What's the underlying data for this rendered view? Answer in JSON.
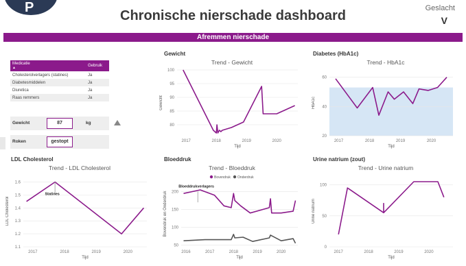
{
  "header": {
    "logo_text": "P",
    "title": "Chronische nierschade dashboard",
    "gender_label": "Geslacht",
    "gender_value": "V"
  },
  "banner": "Afremmen nierschade",
  "medication_table": {
    "headers": [
      "Medicatie",
      "Gebruik"
    ],
    "rows": [
      [
        "Cholesterolverlagers (statines)",
        "Ja"
      ],
      [
        "Diabetesmiddelen",
        "Ja"
      ],
      [
        "Diuretica",
        "Ja"
      ],
      [
        "Raas remmers",
        "Ja"
      ]
    ]
  },
  "fields": {
    "weight_label": "Gewicht",
    "weight_value": "87",
    "weight_unit": "kg",
    "smoking_label": "Roken",
    "smoking_value": "gestopt"
  },
  "panels": {
    "weight": {
      "section": "Gewicht",
      "title": "Trend - Gewicht",
      "xlabel": "Tijd",
      "ylabel": "Gewicht"
    },
    "diabetes": {
      "section": "Diabetes (HbA1c)",
      "title": "Trend - HbA1c",
      "xlabel": "Tijd",
      "ylabel": "HbA1c"
    },
    "ldl": {
      "section": "LDL Cholesterol",
      "title": "Trend - LDL Cholesterol",
      "xlabel": "Tijd",
      "ylabel": "LDL Cholesterol",
      "annotation": "Statines"
    },
    "bp": {
      "section": "Bloeddruk",
      "title": "Trend - Bloeddruk",
      "xlabel": "Tijd",
      "ylabel": "Bovendruk en Onderdruk",
      "annotation": "Bloeddrukverlagers",
      "legend": [
        "Bovendruk",
        "Onderdruk"
      ]
    },
    "sodium": {
      "section": "Urine natrium (zout)",
      "title": "Trend - Urine natrium",
      "xlabel": "Tijd",
      "ylabel": "Urine natrium"
    }
  },
  "colors": {
    "accent": "#8b1a8b",
    "secondary": "#555555",
    "band": "#d6e6f5"
  },
  "chart_data": [
    {
      "type": "line",
      "id": "weight",
      "title": "Trend - Gewicht",
      "xlabel": "Tijd",
      "ylabel": "Gewicht",
      "xlim": [
        2016.7,
        2020.7
      ],
      "ylim": [
        76,
        100
      ],
      "xticks": [
        2017,
        2018,
        2019,
        2020
      ],
      "yticks": [
        80,
        85,
        90,
        95,
        100
      ],
      "x": [
        2016.9,
        2017.9,
        2018.0,
        2018.02,
        2018.05,
        2018.1,
        2018.15,
        2018.2,
        2018.5,
        2018.9,
        2019.5,
        2019.55,
        2020.0,
        2020.6
      ],
      "y": [
        100,
        78,
        77,
        80,
        77,
        78,
        77.5,
        78,
        79,
        81,
        94,
        84,
        84,
        87
      ]
    },
    {
      "type": "line",
      "id": "hba1c",
      "title": "Trend - HbA1c",
      "xlabel": "Tijd",
      "ylabel": "HbA1c",
      "xlim": [
        2016.7,
        2020.7
      ],
      "ylim": [
        20,
        65
      ],
      "xticks": [
        2017,
        2018,
        2019,
        2020
      ],
      "yticks": [
        20,
        40,
        60
      ],
      "band": [
        20,
        53
      ],
      "x": [
        2016.9,
        2017.6,
        2018.1,
        2018.3,
        2018.6,
        2018.8,
        2019.1,
        2019.4,
        2019.6,
        2019.9,
        2020.2,
        2020.5
      ],
      "y": [
        59,
        39,
        53,
        34,
        50,
        45,
        50,
        42,
        52,
        51,
        53,
        60
      ]
    },
    {
      "type": "line",
      "id": "ldl",
      "title": "Trend - LDL Cholesterol",
      "xlabel": "Tijd",
      "ylabel": "LDL Cholesterol",
      "xlim": [
        2016.7,
        2020.6
      ],
      "ylim": [
        1.1,
        1.65
      ],
      "xticks": [
        2017,
        2018,
        2019,
        2020
      ],
      "yticks": [
        1.1,
        1.2,
        1.3,
        1.4,
        1.5,
        1.6
      ],
      "x": [
        2016.8,
        2017.7,
        2019.8,
        2020.5
      ],
      "y": [
        1.45,
        1.6,
        1.2,
        1.4
      ]
    },
    {
      "type": "line",
      "id": "bloeddruk",
      "title": "Trend - Bloeddruk",
      "xlabel": "Tijd",
      "ylabel": "Bovendruk en Onderdruk",
      "xlim": [
        2015.8,
        2020.7
      ],
      "ylim": [
        45,
        230
      ],
      "xticks": [
        2016,
        2017,
        2018,
        2019,
        2020
      ],
      "yticks": [
        50,
        100,
        150,
        200
      ],
      "series": [
        {
          "name": "Bovendruk",
          "x": [
            2015.9,
            2016.6,
            2017.2,
            2017.6,
            2017.9,
            2018.0,
            2018.05,
            2018.3,
            2018.7,
            2019.5,
            2019.55,
            2019.6,
            2020.0,
            2020.5,
            2020.6
          ],
          "y": [
            195,
            205,
            190,
            160,
            155,
            195,
            175,
            160,
            140,
            155,
            180,
            140,
            140,
            145,
            175
          ]
        },
        {
          "name": "Onderdruk",
          "x": [
            2015.9,
            2016.8,
            2017.6,
            2017.9,
            2018.0,
            2018.05,
            2018.4,
            2018.8,
            2019.5,
            2019.55,
            2020.0,
            2020.5,
            2020.6
          ],
          "y": [
            62,
            65,
            65,
            65,
            80,
            70,
            72,
            60,
            70,
            78,
            62,
            68,
            55
          ]
        }
      ]
    },
    {
      "type": "line",
      "id": "natrium",
      "title": "Trend - Urine natrium",
      "xlabel": "Tijd",
      "ylabel": "Urine natrium",
      "xlim": [
        2016.7,
        2020.8
      ],
      "ylim": [
        0,
        115
      ],
      "xticks": [
        2017,
        2018,
        2019,
        2020
      ],
      "yticks": [
        0,
        50,
        100
      ],
      "x": [
        2017.0,
        2017.3,
        2018.5,
        2018.5,
        2018.5,
        2019.5,
        2020.3,
        2020.5
      ],
      "y": [
        20,
        95,
        55,
        70,
        55,
        105,
        105,
        80
      ]
    }
  ]
}
